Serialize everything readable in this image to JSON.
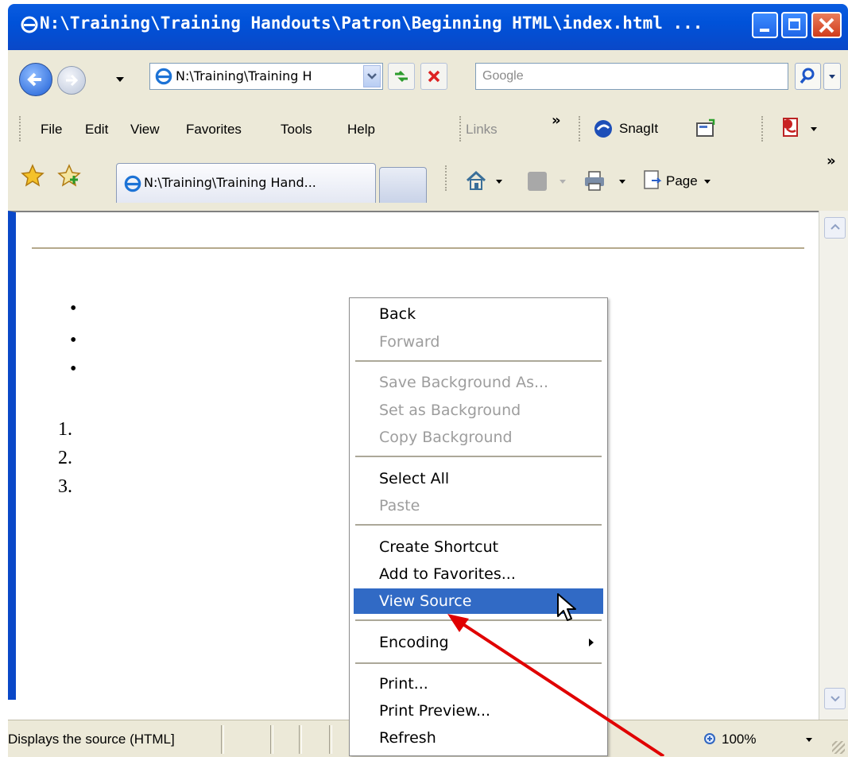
{
  "window": {
    "title": "N:\\Training\\Training Handouts\\Patron\\Beginning HTML\\index.html ..."
  },
  "navbar": {
    "address": "N:\\Training\\Training H",
    "search_placeholder": "Google"
  },
  "menubar": {
    "items": [
      "File",
      "Edit",
      "View",
      "Favorites",
      "Tools",
      "Help"
    ],
    "links_label": "Links",
    "chevron": "»",
    "snagit_label": "SnagIt"
  },
  "favbar": {
    "tab_title": "N:\\Training\\Training Hand...",
    "page_label": "Page",
    "chevron": "»"
  },
  "document": {
    "bullets": [
      "•",
      "•",
      "•"
    ],
    "numbers": [
      "1.",
      "2.",
      "3."
    ]
  },
  "context_menu": {
    "items": [
      {
        "label": "Back",
        "enabled": true
      },
      {
        "label": "Forward",
        "enabled": false
      },
      {
        "label": "Save Background As...",
        "enabled": false
      },
      {
        "label": "Set as Background",
        "enabled": false
      },
      {
        "label": "Copy Background",
        "enabled": false
      },
      {
        "label": "Select All",
        "enabled": true
      },
      {
        "label": "Paste",
        "enabled": false
      },
      {
        "label": "Create Shortcut",
        "enabled": true
      },
      {
        "label": "Add to Favorites...",
        "enabled": true
      },
      {
        "label": "View Source",
        "enabled": true,
        "highlighted": true
      },
      {
        "label": "Encoding",
        "enabled": true,
        "submenu": true
      },
      {
        "label": "Print...",
        "enabled": true
      },
      {
        "label": "Print Preview...",
        "enabled": true
      },
      {
        "label": "Refresh",
        "enabled": true
      }
    ]
  },
  "status": {
    "text": "Displays the source (HTML]",
    "zoom": "100%"
  },
  "colors": {
    "highlight": "#316ac5",
    "arrow": "#e00000",
    "titlebar": "#0052d9"
  }
}
